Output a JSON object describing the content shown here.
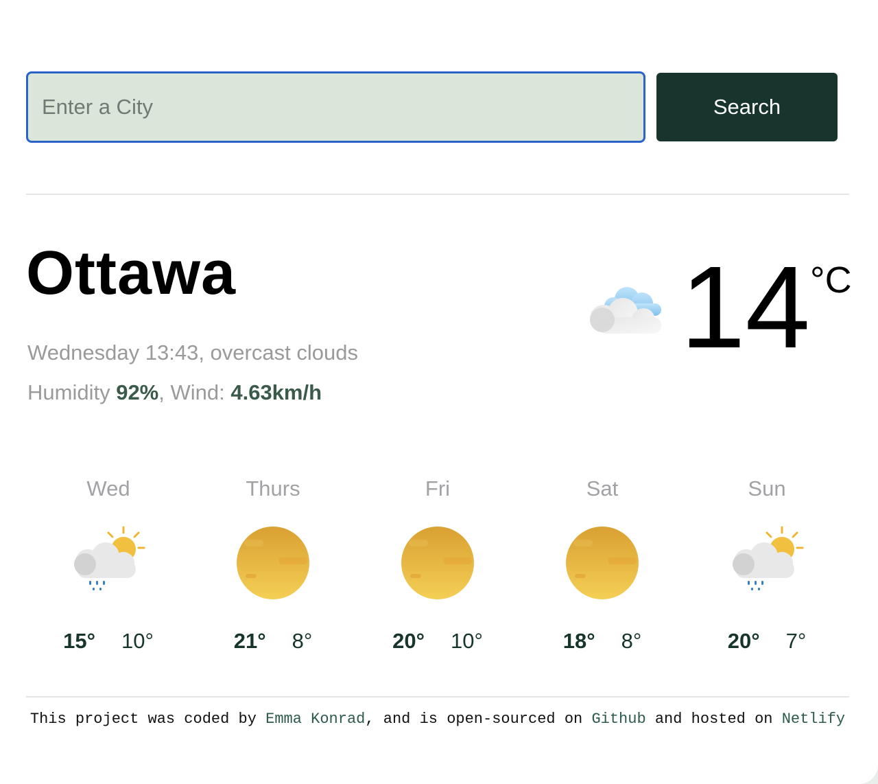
{
  "search": {
    "placeholder": "Enter a City",
    "button_label": "Search"
  },
  "current": {
    "city": "Ottawa",
    "datetime_description": "Wednesday 13:43, overcast clouds",
    "humidity_label": "Humidity ",
    "humidity_value": "92%",
    "wind_label": ", Wind: ",
    "wind_value": "4.63km/h",
    "temperature": "14",
    "unit": "°C",
    "icon": "overcast-clouds-icon"
  },
  "forecast": [
    {
      "day": "Wed",
      "max": "15°",
      "min": "10°",
      "icon": "rain-sun-cloud-icon"
    },
    {
      "day": "Thurs",
      "max": "21°",
      "min": "8°",
      "icon": "sun-haze-icon"
    },
    {
      "day": "Fri",
      "max": "20°",
      "min": "10°",
      "icon": "sun-haze-icon"
    },
    {
      "day": "Sat",
      "max": "18°",
      "min": "8°",
      "icon": "sun-haze-icon"
    },
    {
      "day": "Sun",
      "max": "20°",
      "min": "7°",
      "icon": "rain-sun-cloud-icon"
    }
  ],
  "footer": {
    "prefix": "This project was coded by ",
    "author_link": "Emma Konrad",
    "middle": ", and is open-sourced on ",
    "github_link": "Github",
    "middle2": " and hosted on ",
    "netlify_link": "Netlify"
  },
  "colors": {
    "accent_dark_green": "#17352d",
    "input_background": "#dbe6da",
    "input_border": "#2b62c7",
    "muted_text": "#9a9a9a",
    "link": "#2d5a4a",
    "sun": "#f0c040"
  }
}
